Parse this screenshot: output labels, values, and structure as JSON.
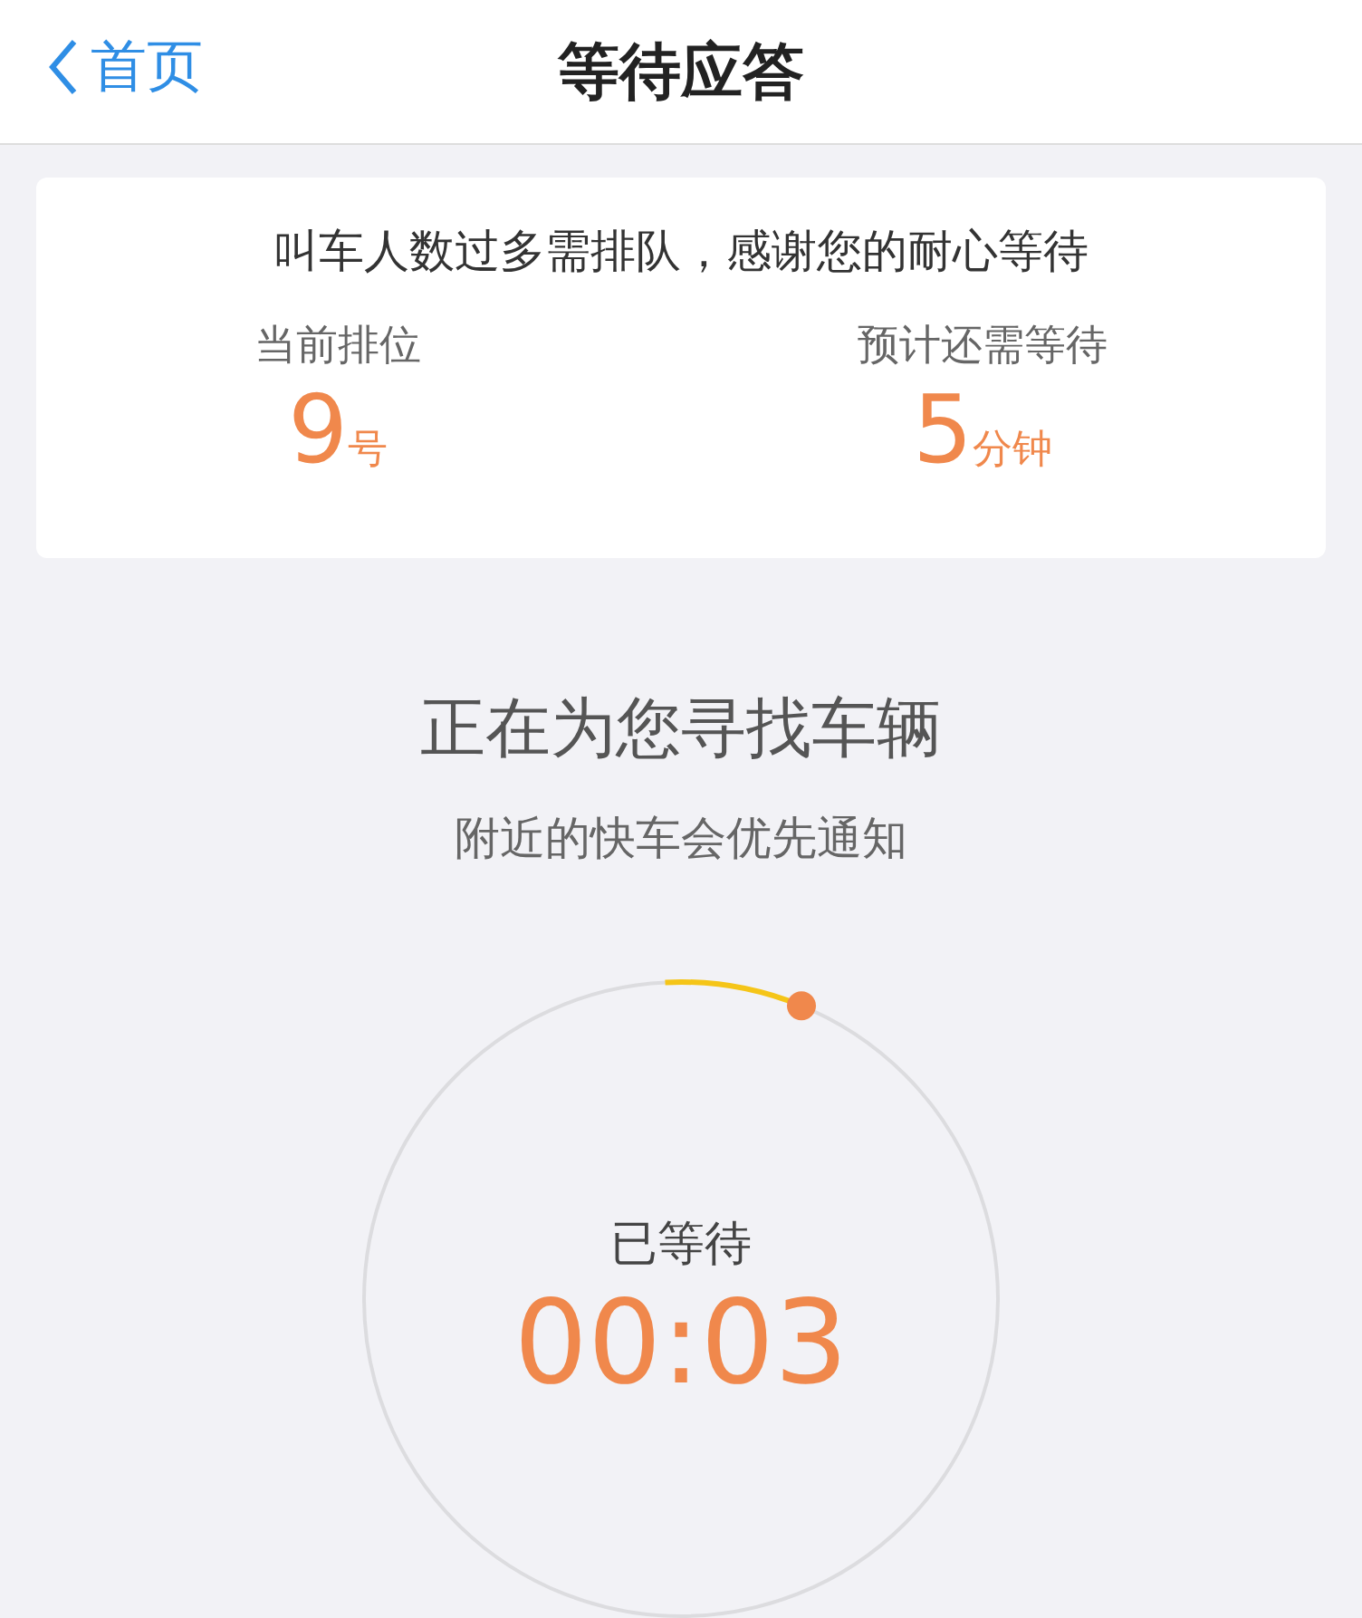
{
  "nav": {
    "back": "首页",
    "title": "等待应答"
  },
  "queue": {
    "notice": "叫车人数过多需排队，感谢您的耐心等待",
    "stats": [
      {
        "label": "当前排位",
        "value": "9",
        "unit": "号"
      },
      {
        "label": "预计还需等待",
        "value": "5",
        "unit": "分钟"
      }
    ]
  },
  "search": {
    "title": "正在为您寻找车辆",
    "subtitle": "附近的快车会优先通知"
  },
  "timer": {
    "label": "已等待",
    "time": "00:03"
  }
}
